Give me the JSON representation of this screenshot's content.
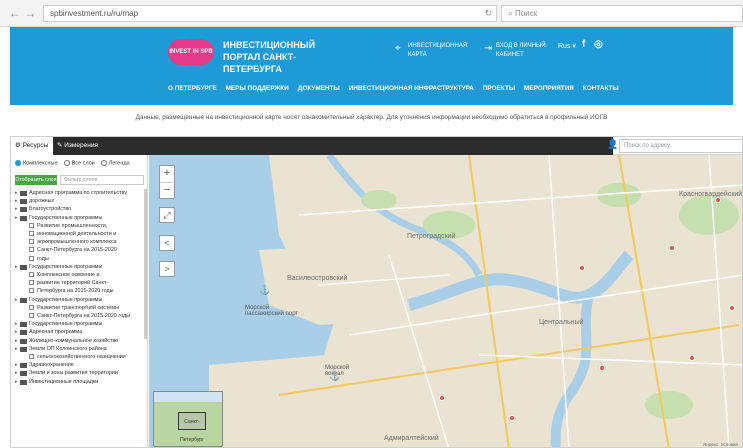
{
  "browser": {
    "url": "spbinvestment.ru/ru/map",
    "search_placeholder": "Поиск",
    "back_icon": "arrow-left-icon",
    "reload_icon": "reload-icon"
  },
  "header": {
    "logo_text": "INVEST IN SPB",
    "title": "ИНВЕСТИЦИОННЫЙ ПОРТАЛ САНКТ-ПЕТЕРБУРГА",
    "map_link": "ИНВЕСТИЦИОННАЯ КАРТА",
    "cabinet_link": "ВХОД В ЛИЧНЫЙ КАБИНЕТ",
    "lang": "Rus",
    "facebook_label": "f",
    "instagram_label": "◎",
    "colors": {
      "header_bg": "#1e9ad6",
      "logo_bg": "#e53a87"
    }
  },
  "nav": {
    "items": [
      "О ПЕТЕРБУРГЕ",
      "МЕРЫ ПОДДЕРЖКИ",
      "ДОКУМЕНТЫ",
      "ИНВЕСТИЦИОННАЯ ИНФРАСТРУКТУРА",
      "ПРОЕКТЫ",
      "МЕРОПРИЯТИЯ",
      "КОНТАКТЫ"
    ]
  },
  "notice": "Данные, размещенные на инвестиционной карте носят ознакомительный характер. Для уточнения информации необходимо обратиться в профильный ИОГВ",
  "panel": {
    "tab_resources": "Ресурсы",
    "tab_measure": "Измерения",
    "map_search_placeholder": "Поиск по адресу",
    "radio_options": [
      {
        "label": "Комплексные",
        "selected": true
      },
      {
        "label": "Все слои",
        "selected": false
      },
      {
        "label": "Легенда",
        "selected": false
      }
    ],
    "show_all_button": "Отобразить слои",
    "filter_placeholder": "Фильтр слоев",
    "tree": [
      {
        "label": "Адресная программа по строительству",
        "level": 0
      },
      {
        "label": "дорожных",
        "level": 0
      },
      {
        "label": "Благоустройство",
        "level": 0
      },
      {
        "label": "Государственные программы",
        "level": 0
      },
      {
        "label": "Развитие промышленности,",
        "level": 1
      },
      {
        "label": "инновационной деятельности и",
        "level": 1
      },
      {
        "label": "агропромышленного комплекса",
        "level": 1
      },
      {
        "label": "Санкт-Петербурга на 2015-2020",
        "level": 1
      },
      {
        "label": "годы",
        "level": 1
      },
      {
        "label": "Государственные программы",
        "level": 0
      },
      {
        "label": "Комплексное освоение и",
        "level": 1
      },
      {
        "label": "развитие территорий Санкт-",
        "level": 1
      },
      {
        "label": "Петербурга на 2015-2020 годы",
        "level": 1
      },
      {
        "label": "Государственные программы",
        "level": 0
      },
      {
        "label": "Развитие транспортной системы",
        "level": 1
      },
      {
        "label": "Санкт-Петербурга на 2015-2020 годы",
        "level": 1
      },
      {
        "label": "Государственные программы",
        "level": 0
      },
      {
        "label": "Адресная программа",
        "level": 0
      },
      {
        "label": "Жилищно-коммунальное хозяйство",
        "level": 0
      },
      {
        "label": "Земли ОП Колпинского района",
        "level": 0
      },
      {
        "label": "сельскохозяйственного назначения",
        "level": 1
      },
      {
        "label": "Здравоохранение",
        "level": 0
      },
      {
        "label": "Земли и зоны развития территории",
        "level": 0
      },
      {
        "label": "Инвестиционные площадки",
        "level": 0
      }
    ]
  },
  "map": {
    "labels": {
      "petrogradsky": "Петроградский",
      "vasileostrovsky": "Василеостровский",
      "admiralteysky": "Адмиралтейский",
      "tsentralny": "Центральный",
      "krasnogvardeysky": "Красногвардейский",
      "sea_port": "Морской пассажирский порт",
      "sea_station": "Морской вокзал"
    },
    "minimap_label": "Санкт-Петербург",
    "attribution": "Яндекс. Условия"
  }
}
